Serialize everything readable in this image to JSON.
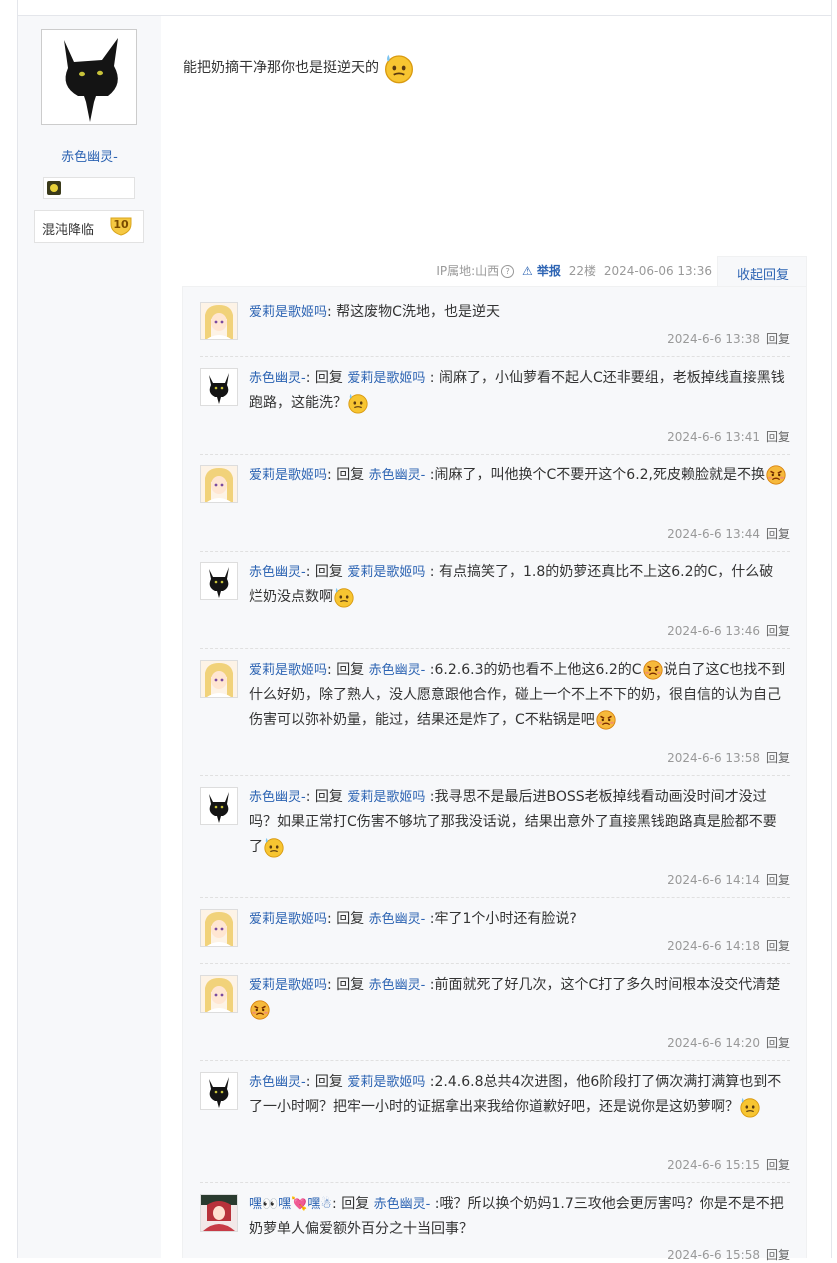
{
  "author": {
    "name": "赤色幽灵-",
    "level_title": "混沌降临",
    "level_num": "10"
  },
  "post": {
    "text": "能把奶摘干净那你也是挺逆天的",
    "ip": "IP属地:山西",
    "report": "举报",
    "floor": "22楼",
    "time": "2024-06-06 13:36",
    "collapse": "收起回复"
  },
  "replies": [
    {
      "user": "爱莉是歌姬吗",
      "avatar": "girl",
      "reply_label": "",
      "reply_to": "",
      "text": ": 帮这废物C洗地，也是逆天",
      "time": "2024-6-6 13:38",
      "action": "回复"
    },
    {
      "user": "赤色幽灵-",
      "avatar": "cat",
      "reply_label": "回复",
      "reply_to": "爱莉是歌姬吗",
      "text": " : 闹麻了，小仙萝看不起人C还非要组，老板掉线直接黑钱跑路，这能洗？",
      "time": "2024-6-6 13:41",
      "action": "回复"
    },
    {
      "user": "爱莉是歌姬吗",
      "avatar": "girl",
      "reply_label": "回复",
      "reply_to": "赤色幽灵-",
      "text": " :闹麻了，叫他换个C不要开这个6.2,死皮赖脸就是不换",
      "time": "2024-6-6 13:44",
      "action": "回复"
    },
    {
      "user": "赤色幽灵-",
      "avatar": "cat",
      "reply_label": "回复",
      "reply_to": "爱莉是歌姬吗",
      "text": " : 有点搞笑了，1.8的奶萝还真比不上这6.2的C，什么破 烂奶没点数啊",
      "time": "2024-6-6 13:46",
      "action": "回复"
    },
    {
      "user": "爱莉是歌姬吗",
      "avatar": "girl",
      "reply_label": "回复",
      "reply_to": "赤色幽灵-",
      "text": " :6.2.6.3的奶也看不上他这6.2的C",
      "text2": "说白了这C也找不到什么好奶，除了熟人，没人愿意跟他合作，碰上一个不上不下的奶，很自信的认为自己伤害可以弥补奶量，能过，结果还是炸了，C不粘锅是吧",
      "time": "2024-6-6 13:58",
      "action": "回复"
    },
    {
      "user": "赤色幽灵-",
      "avatar": "cat",
      "reply_label": "回复",
      "reply_to": "爱莉是歌姬吗",
      "text": " :我寻思不是最后进BOSS老板掉线看动画没时间才没过吗？如果正常打C伤害不够坑了那我没话说，结果出意外了直接黑钱跑路真是脸都不要了",
      "time": "2024-6-6 14:14",
      "action": "回复"
    },
    {
      "user": "爱莉是歌姬吗",
      "avatar": "girl",
      "reply_label": "回复",
      "reply_to": "赤色幽灵-",
      "text": " :牢了1个小时还有脸说?",
      "time": "2024-6-6 14:18",
      "action": "回复"
    },
    {
      "user": "爱莉是歌姬吗",
      "avatar": "girl",
      "reply_label": "回复",
      "reply_to": "赤色幽灵-",
      "text": " :前面就死了好几次，这个C打了多久时间根本没交代清楚",
      "time": "2024-6-6 14:20",
      "action": "回复"
    },
    {
      "user": "赤色幽灵-",
      "avatar": "cat",
      "reply_label": "回复",
      "reply_to": "爱莉是歌姬吗",
      "text": " :2.4.6.8总共4次进图，他6阶段打了俩次满打满算也到不了一小时啊？把牢一小时的证据拿出来我给你道歉好吧，还是说你是这奶萝啊？",
      "time": "2024-6-6 15:15",
      "action": "回复"
    },
    {
      "user": "嘿👀嘿💘嘿☃",
      "avatar": "anime",
      "reply_label": "回复",
      "reply_to": "赤色幽灵-",
      "text": " :哦？所以换个奶妈1.7三攻他会更厉害吗？你是不是不把奶萝单人偏爱额外百分之十当回事？",
      "time": "2024-6-6 15:58",
      "action": "回复"
    }
  ]
}
